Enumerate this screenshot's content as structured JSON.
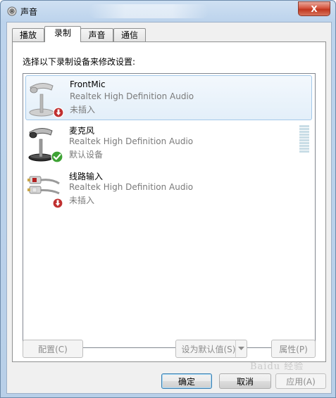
{
  "window": {
    "title": "声音",
    "close_label": "X"
  },
  "tabs": [
    {
      "label": "播放"
    },
    {
      "label": "录制"
    },
    {
      "label": "声音"
    },
    {
      "label": "通信"
    }
  ],
  "active_tab": 1,
  "panel": {
    "prompt": "选择以下录制设备来修改设置:"
  },
  "devices": [
    {
      "name": "FrontMic",
      "driver": "Realtek High Definition Audio",
      "status": "未插入",
      "selected": true,
      "icon": "microphone-icon",
      "badge": "unplugged-badge-icon"
    },
    {
      "name": "麦克风",
      "driver": "Realtek High Definition Audio",
      "status": "默认设备",
      "selected": false,
      "icon": "microphone-icon",
      "badge": "default-check-badge-icon"
    },
    {
      "name": "线路输入",
      "driver": "Realtek High Definition Audio",
      "status": "未插入",
      "selected": false,
      "icon": "line-in-cable-icon",
      "badge": "unplugged-badge-icon"
    }
  ],
  "buttons": {
    "configure": "配置(C)",
    "set_default": "设为默认值(S)",
    "properties": "属性(P)",
    "ok": "确定",
    "cancel": "取消",
    "apply": "应用(A)"
  },
  "watermark": "Baidu 经验",
  "colors": {
    "selection_border": "#a3c9ea",
    "close_red": "#c0371f",
    "check_green": "#3da234",
    "unplug_red": "#c03030"
  }
}
